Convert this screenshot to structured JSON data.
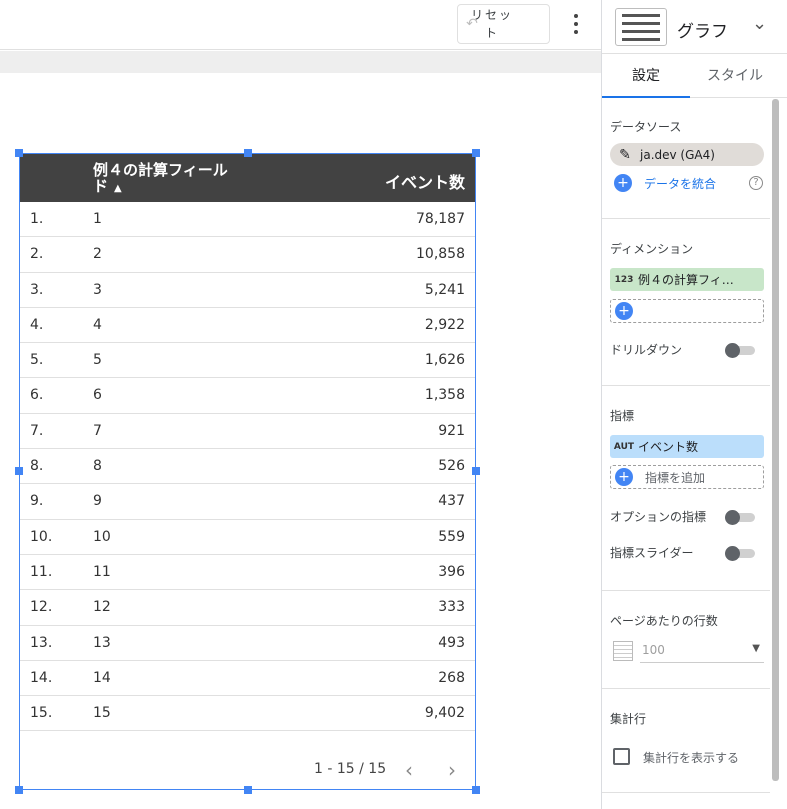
{
  "toolbar": {
    "reset_label": "リセット",
    "reset_icon": "undo-icon",
    "more_icon": "more-vert-icon"
  },
  "table": {
    "headers": {
      "dimension": "例４の計算フィールド",
      "metric": "イベント数"
    },
    "sort_icon": "sort-ascending-icon",
    "rows": [
      {
        "idx": "1.",
        "dim": "1",
        "val": "78,187"
      },
      {
        "idx": "2.",
        "dim": "2",
        "val": "10,858"
      },
      {
        "idx": "3.",
        "dim": "3",
        "val": "5,241"
      },
      {
        "idx": "4.",
        "dim": "4",
        "val": "2,922"
      },
      {
        "idx": "5.",
        "dim": "5",
        "val": "1,626"
      },
      {
        "idx": "6.",
        "dim": "6",
        "val": "1,358"
      },
      {
        "idx": "7.",
        "dim": "7",
        "val": "921"
      },
      {
        "idx": "8.",
        "dim": "8",
        "val": "526"
      },
      {
        "idx": "9.",
        "dim": "9",
        "val": "437"
      },
      {
        "idx": "10.",
        "dim": "10",
        "val": "559"
      },
      {
        "idx": "11.",
        "dim": "11",
        "val": "396"
      },
      {
        "idx": "12.",
        "dim": "12",
        "val": "333"
      },
      {
        "idx": "13.",
        "dim": "13",
        "val": "493"
      },
      {
        "idx": "14.",
        "dim": "14",
        "val": "268"
      },
      {
        "idx": "15.",
        "dim": "15",
        "val": "9,402"
      }
    ],
    "pagination": "1 - 15 / 15"
  },
  "panel": {
    "chart_type": "グラフ",
    "tabs": [
      "設定",
      "スタイル"
    ],
    "data_source": {
      "title": "データソース",
      "name": "ja.dev (GA4)",
      "blend": "データを統合"
    },
    "dimension": {
      "title": "ディメンション",
      "tag": "123",
      "chip": "例４の計算フィ…",
      "drilldown": "ドリルダウン"
    },
    "metric": {
      "title": "指標",
      "tag": "AUT",
      "chip": "イベント数",
      "add": "指標を追加",
      "optional": "オプションの指標",
      "slider": "指標スライダー"
    },
    "rows_per_page": {
      "title": "ページあたりの行数",
      "value": "100"
    },
    "summary": {
      "title": "集計行",
      "checkbox": "集計行を表示する"
    }
  },
  "colors": {
    "accent": "#4285f4",
    "header_bg": "#424242",
    "dimension_chip": "#c8e6c9",
    "metric_chip": "#bbdefb"
  }
}
